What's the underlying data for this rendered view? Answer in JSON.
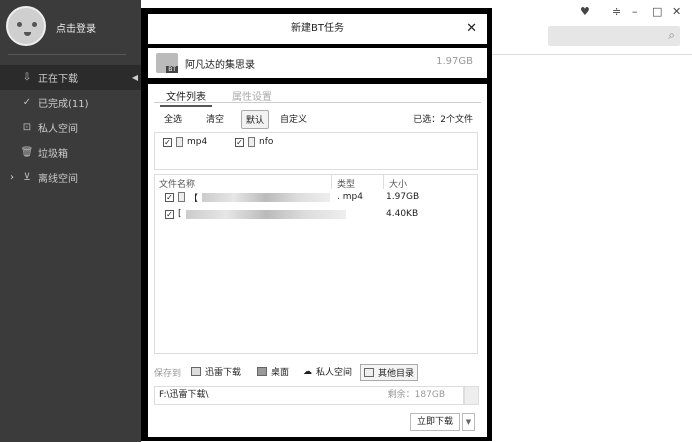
{
  "sidebar": {
    "login": "点击登录",
    "items": [
      {
        "label": "正在下载",
        "icon": "download-icon"
      },
      {
        "label": "已完成(11)",
        "icon": "check-circle-icon"
      },
      {
        "label": "私人空间",
        "icon": "lock-icon"
      },
      {
        "label": "垃圾箱",
        "icon": "trash-icon"
      },
      {
        "label": "离线空间",
        "icon": "cloud-download-icon"
      }
    ]
  },
  "dialog": {
    "title": "新建BT任务",
    "close": "✕",
    "torrent": {
      "name": "阿凡达的集思录",
      "size": "1.97GB",
      "badge": "BT"
    },
    "tabs": [
      "文件列表",
      "属性设置"
    ],
    "buttons": [
      "全选",
      "清空",
      "默认",
      "自定义"
    ],
    "selected": "已选：2个文件",
    "filters": [
      "mp4",
      "nfo"
    ],
    "columns": [
      "文件名称",
      "类型",
      "大小"
    ],
    "files": [
      {
        "prefix": "【",
        "type": ". mp4",
        "size": "1.97GB"
      },
      {
        "prefix": "[",
        "type": "",
        "size": "4.40KB"
      }
    ],
    "save_label": "保存到",
    "save_options": [
      "迅雷下载",
      "桌面",
      "私人空间",
      "其他目录"
    ],
    "path": "F:\\迅雷下载\\",
    "remaining": "剩余：187GB",
    "download": "立即下载"
  }
}
